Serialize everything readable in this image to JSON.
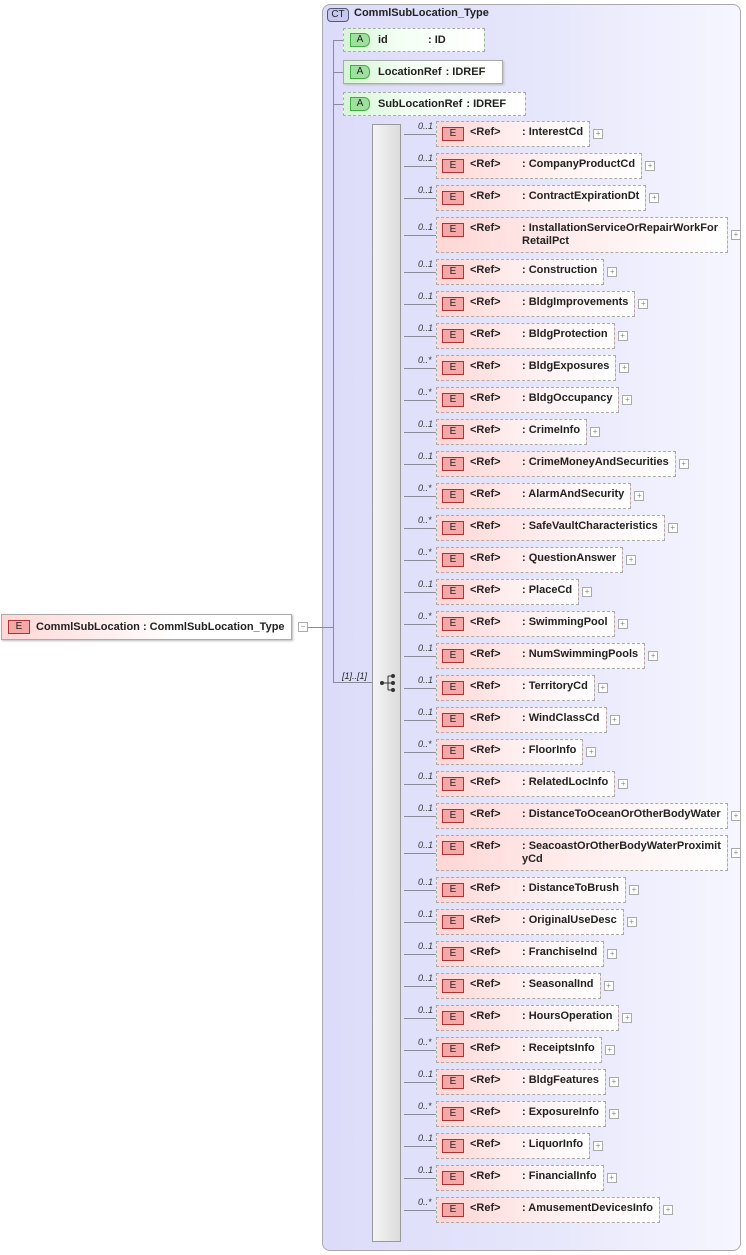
{
  "complex_type": {
    "badge": "CT",
    "name": "CommlSubLocation_Type"
  },
  "root_element": {
    "badge": "E",
    "label": "CommlSubLocation : CommlSubLocation_Type",
    "toggle": "−"
  },
  "attributes": [
    {
      "badge": "A",
      "name": "id",
      "type": ": ID",
      "optional": true
    },
    {
      "badge": "A",
      "name": "LocationRef",
      "type": ": IDREF",
      "optional": false
    },
    {
      "badge": "A",
      "name": "SubLocationRef",
      "type": ": IDREF",
      "optional": true
    }
  ],
  "sequence": {
    "multiplicity": "[1]..[1]",
    "icon": "sequence-icon"
  },
  "child_badge": "E",
  "child_ref": "<Ref>",
  "child_expand": "+",
  "children": [
    {
      "mult": "0..1",
      "name": ": InterestCd"
    },
    {
      "mult": "0..1",
      "name": ": CompanyProductCd"
    },
    {
      "mult": "0..1",
      "name": ": ContractExpirationDt"
    },
    {
      "mult": "0..1",
      "name": ": InstallationServiceOrRepairWorkForRetailPct",
      "wrap": true
    },
    {
      "mult": "0..1",
      "name": ": Construction"
    },
    {
      "mult": "0..1",
      "name": ": BldgImprovements"
    },
    {
      "mult": "0..1",
      "name": ": BldgProtection"
    },
    {
      "mult": "0..*",
      "name": ": BldgExposures"
    },
    {
      "mult": "0..*",
      "name": ": BldgOccupancy"
    },
    {
      "mult": "0..1",
      "name": ": CrimeInfo"
    },
    {
      "mult": "0..1",
      "name": ": CrimeMoneyAndSecurities"
    },
    {
      "mult": "0..*",
      "name": ": AlarmAndSecurity"
    },
    {
      "mult": "0..*",
      "name": ": SafeVaultCharacteristics"
    },
    {
      "mult": "0..*",
      "name": ": QuestionAnswer"
    },
    {
      "mult": "0..1",
      "name": ": PlaceCd"
    },
    {
      "mult": "0..*",
      "name": ": SwimmingPool"
    },
    {
      "mult": "0..1",
      "name": ": NumSwimmingPools"
    },
    {
      "mult": "0..1",
      "name": ": TerritoryCd"
    },
    {
      "mult": "0..1",
      "name": ": WindClassCd"
    },
    {
      "mult": "0..*",
      "name": ": FloorInfo"
    },
    {
      "mult": "0..1",
      "name": ": RelatedLocInfo"
    },
    {
      "mult": "0..1",
      "name": ": DistanceToOceanOrOtherBodyWater",
      "wrap": true
    },
    {
      "mult": "0..1",
      "name": ": SeacoastOrOtherBodyWaterProximityCd",
      "wrap": true
    },
    {
      "mult": "0..1",
      "name": ": DistanceToBrush"
    },
    {
      "mult": "0..1",
      "name": ": OriginalUseDesc"
    },
    {
      "mult": "0..1",
      "name": ": FranchiseInd"
    },
    {
      "mult": "0..1",
      "name": ": SeasonalInd"
    },
    {
      "mult": "0..1",
      "name": ": HoursOperation"
    },
    {
      "mult": "0..*",
      "name": ": ReceiptsInfo"
    },
    {
      "mult": "0..1",
      "name": ": BldgFeatures"
    },
    {
      "mult": "0..*",
      "name": ": ExposureInfo"
    },
    {
      "mult": "0..1",
      "name": ": LiquorInfo"
    },
    {
      "mult": "0..1",
      "name": ": FinancialInfo"
    },
    {
      "mult": "0..*",
      "name": ": AmusementDevicesInfo"
    }
  ]
}
